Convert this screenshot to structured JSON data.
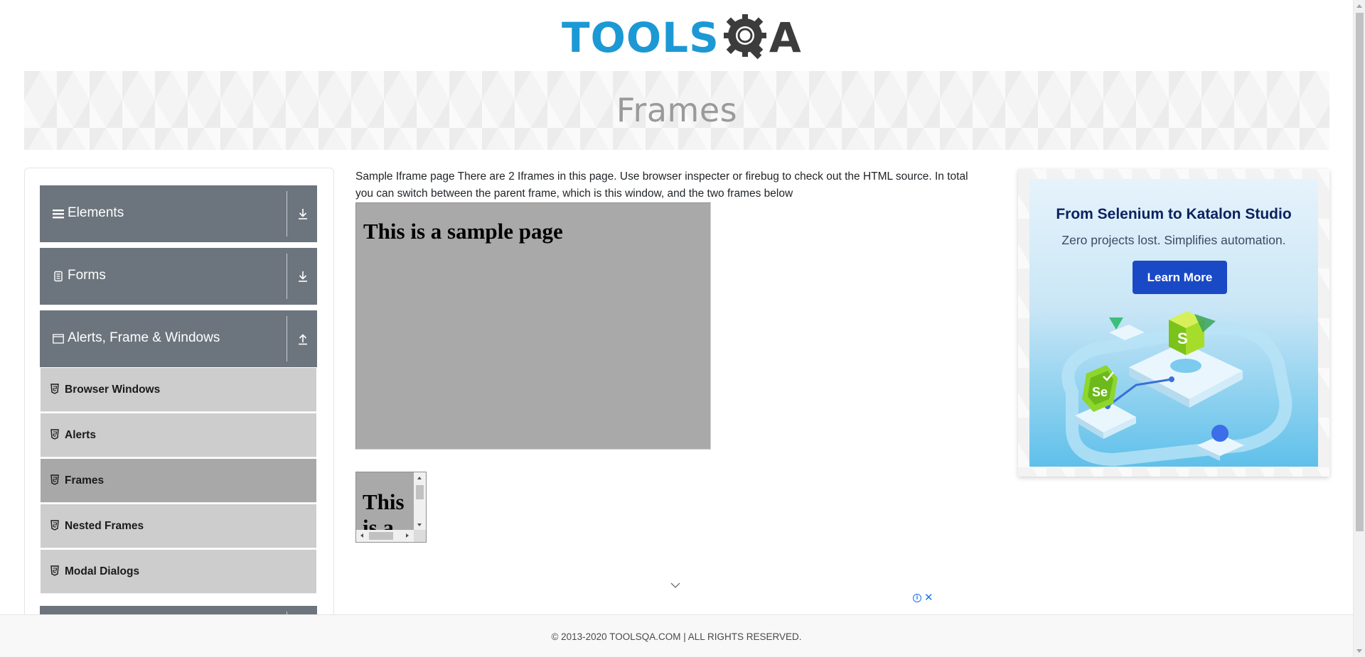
{
  "header": {
    "logo_text_left": "TOOLS",
    "logo_text_right": "A",
    "logo_icon": "gear-magnifier-icon"
  },
  "banner": {
    "title": "Frames"
  },
  "sidebar": {
    "groups": [
      {
        "label": "Elements",
        "icon": "hamburger-icon",
        "state_icon": "download-arrow-icon"
      },
      {
        "label": "Forms",
        "icon": "document-icon",
        "state_icon": "download-arrow-icon"
      },
      {
        "label": "Alerts, Frame & Windows",
        "icon": "window-icon",
        "state_icon": "upload-arrow-icon"
      }
    ],
    "subitems": [
      {
        "label": "Browser Windows",
        "icon": "html5-shield-icon"
      },
      {
        "label": "Alerts",
        "icon": "html5-shield-icon"
      },
      {
        "label": "Frames",
        "icon": "html5-shield-icon",
        "active": true
      },
      {
        "label": "Nested Frames",
        "icon": "html5-shield-icon"
      },
      {
        "label": "Modal Dialogs",
        "icon": "html5-shield-icon"
      }
    ]
  },
  "main": {
    "intro": "Sample Iframe page There are 2 Iframes in this page. Use browser inspecter or firebug to check out the HTML source. In total you can switch between the parent frame, which is this window, and the two frames below",
    "frame1_heading": "This is a sample page",
    "frame2_heading": "This is a sample page"
  },
  "ad": {
    "title": "From Selenium to Katalon Studio",
    "subtitle": "Zero projects lost. Simplifies automation.",
    "button": "Learn More",
    "badge_s": "S",
    "badge_se": "Se"
  },
  "footer": {
    "copyright": "© 2013-2020 TOOLSQA.COM | ALL RIGHTS RESERVED."
  },
  "colors": {
    "logo_blue": "#1c99d5",
    "logo_dark": "#3c3c3c",
    "sidebar_group": "#6c757d",
    "sidebar_sub": "#cdcdcd",
    "sidebar_active": "#a8a8a8",
    "frame_bg": "#a9a9a9",
    "ad_button": "#1a49c6"
  }
}
